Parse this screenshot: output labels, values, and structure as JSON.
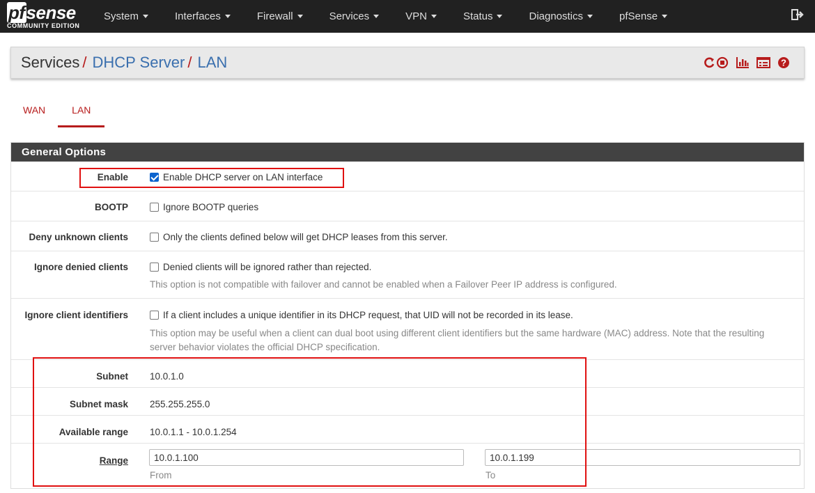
{
  "brand": {
    "logo_pf": "pf",
    "logo_sense": "sense",
    "edition": "COMMUNITY EDITION"
  },
  "nav": {
    "items": [
      "System",
      "Interfaces",
      "Firewall",
      "Services",
      "VPN",
      "Status",
      "Diagnostics",
      "pfSense"
    ]
  },
  "breadcrumb": {
    "root": "Services",
    "sep": "/",
    "level1": "DHCP Server",
    "level2": "LAN"
  },
  "tabs": [
    {
      "label": "WAN",
      "active": false
    },
    {
      "label": "LAN",
      "active": true
    }
  ],
  "section": {
    "title": "General Options"
  },
  "rows": {
    "enable": {
      "label": "Enable",
      "text": "Enable DHCP server on LAN interface",
      "checked": true
    },
    "bootp": {
      "label": "BOOTP",
      "text": "Ignore BOOTP queries",
      "checked": false
    },
    "deny_unknown": {
      "label": "Deny unknown clients",
      "text": "Only the clients defined below will get DHCP leases from this server.",
      "checked": false
    },
    "ignore_denied": {
      "label": "Ignore denied clients",
      "text": "Denied clients will be ignored rather than rejected.",
      "help": "This option is not compatible with failover and cannot be enabled when a Failover Peer IP address is configured.",
      "checked": false
    },
    "ignore_identifiers": {
      "label": "Ignore client identifiers",
      "text": "If a client includes a unique identifier in its DHCP request, that UID will not be recorded in its lease.",
      "help_line1": "This option may be useful when a client can dual boot using different client identifiers but the same hardware (MAC) address. Note that the resulting",
      "help_line2": "server behavior violates the official DHCP specification.",
      "checked": false
    },
    "subnet": {
      "label": "Subnet",
      "value": "10.0.1.0"
    },
    "subnet_mask": {
      "label": "Subnet mask",
      "value": "255.255.255.0"
    },
    "available_range": {
      "label": "Available range",
      "value": "10.0.1.1 - 10.0.1.254"
    },
    "range": {
      "label": "Range",
      "from_value": "10.0.1.100",
      "from_hint": "From",
      "to_value": "10.0.1.199",
      "to_hint": "To"
    }
  },
  "icons": [
    "restart-icon",
    "stop-icon",
    "chart-icon",
    "log-icon",
    "help-icon"
  ],
  "colors": {
    "navbar": "#212121",
    "accent": "#b71c1c",
    "link": "#3a6fae",
    "section_header": "#424242",
    "highlight": "#e01010"
  }
}
